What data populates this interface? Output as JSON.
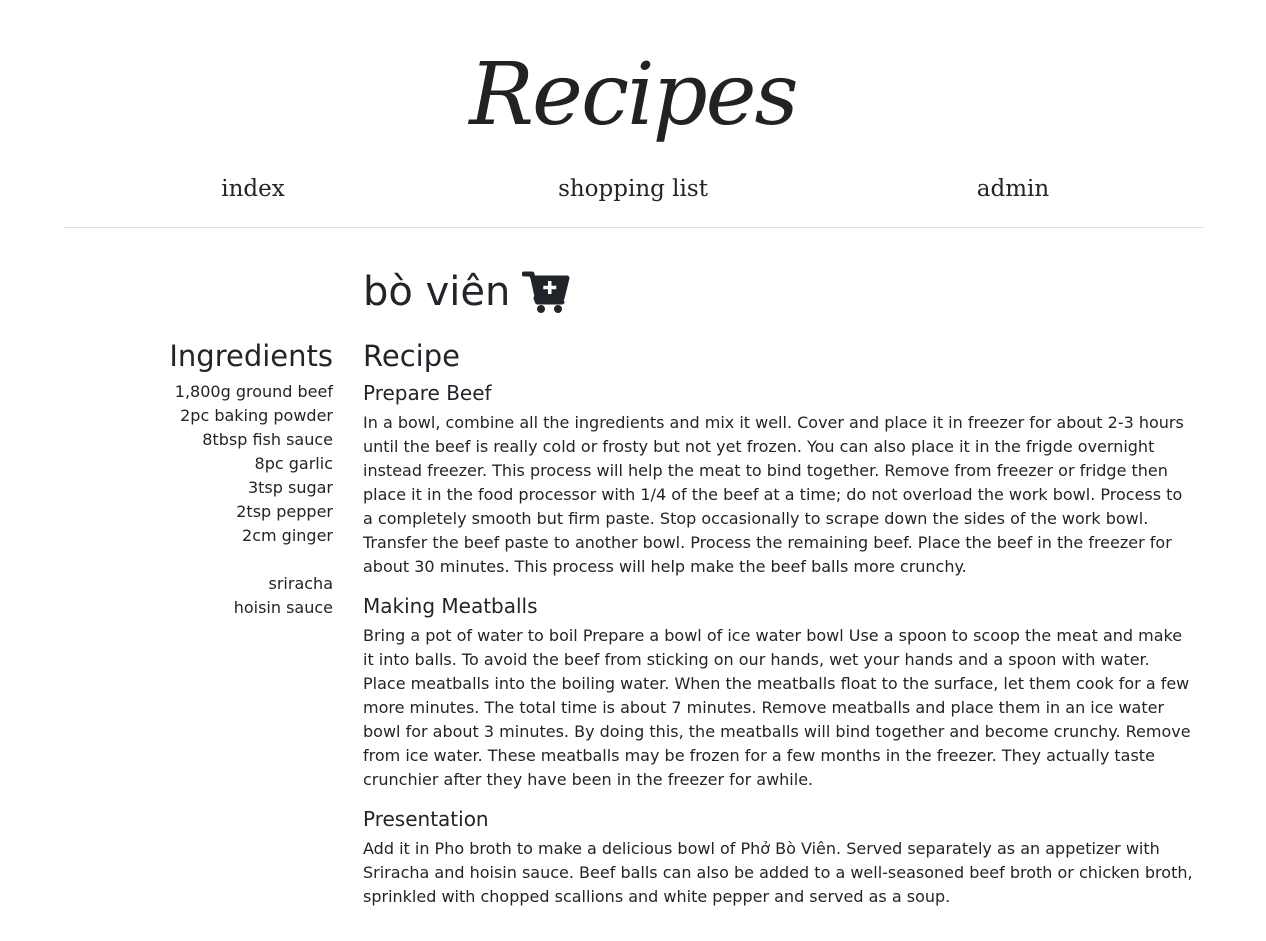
{
  "site": {
    "title": "Recipes"
  },
  "nav": {
    "index": "index",
    "shopping_list": "shopping list",
    "admin": "admin"
  },
  "recipe": {
    "name": "bò viên",
    "cart_icon": "cart-plus-icon"
  },
  "ingredients": {
    "heading": "Ingredients",
    "items": [
      "1,800g ground beef",
      "2pc baking powder",
      "8tbsp fish sauce",
      "8pc garlic",
      "3tsp sugar",
      "2tsp pepper",
      "2cm ginger",
      "",
      "sriracha",
      "hoisin sauce"
    ]
  },
  "instructions": {
    "heading": "Recipe",
    "sections": [
      {
        "title": "Prepare Beef",
        "text": "In a bowl, combine all the ingredients and mix it well. Cover and place it in freezer for about 2-3 hours until the beef is really cold or frosty but not yet frozen. You can also place it in the frigde overnight instead freezer. This process will help the meat to bind together. Remove from freezer or fridge then place it in the food processor with 1/4 of the beef at a time; do not overload the work bowl. Process to a completely smooth but firm paste. Stop occasionally to scrape down the sides of the work bowl. Transfer the beef paste to another bowl. Process the remaining beef. Place the beef in the freezer for about 30 minutes. This process will help make the beef balls more crunchy."
      },
      {
        "title": "Making Meatballs",
        "text": "Bring a pot of water to boil Prepare a bowl of ice water bowl Use a spoon to scoop the meat and make it into balls. To avoid the beef from sticking on our hands, wet your hands and a spoon with water. Place meatballs into the boiling water. When the meatballs float to the surface, let them cook for a few more minutes. The total time is about 7 minutes. Remove meatballs and place them in an ice water bowl for about 3 minutes. By doing this, the meatballs will bind together and become crunchy. Remove from ice water. These meatballs may be frozen for a few months in the freezer. They actually taste crunchier after they have been in the freezer for awhile."
      },
      {
        "title": "Presentation",
        "text": "Add it in Pho broth to make a delicious bowl of Phở Bò Viên. Served separately as an appetizer with Sriracha and hoisin sauce. Beef balls can also be added to a well-seasoned beef broth or chicken broth, sprinkled with chopped scallions and white pepper and served as a soup."
      }
    ]
  }
}
